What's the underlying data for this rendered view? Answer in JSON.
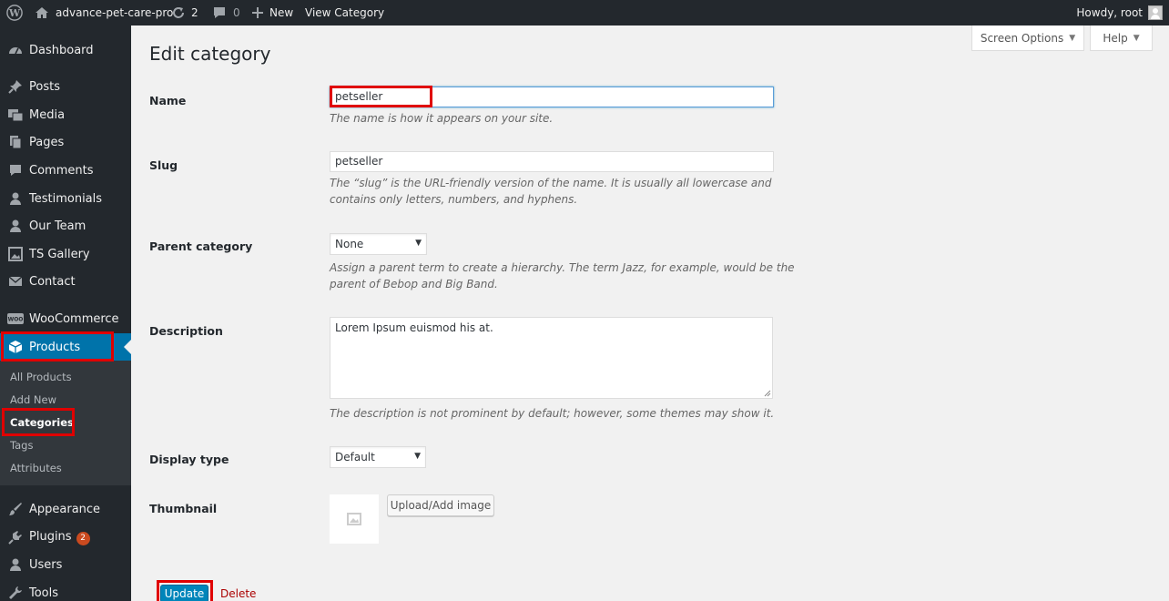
{
  "adminbar": {
    "site_name": "advance-pet-care-pro",
    "updates_count": "2",
    "comments_count": "0",
    "new_label": "New",
    "view_label": "View Category",
    "howdy": "Howdy, root"
  },
  "sidebar": {
    "items": [
      {
        "label": "Dashboard",
        "icon": "dashboard-icon"
      },
      {
        "label": "Posts",
        "icon": "pin-icon"
      },
      {
        "label": "Media",
        "icon": "media-icon"
      },
      {
        "label": "Pages",
        "icon": "pages-icon"
      },
      {
        "label": "Comments",
        "icon": "comment-icon"
      },
      {
        "label": "Testimonials",
        "icon": "person-icon"
      },
      {
        "label": "Our Team",
        "icon": "person-icon"
      },
      {
        "label": "TS Gallery",
        "icon": "gallery-icon"
      },
      {
        "label": "Contact",
        "icon": "mail-icon"
      },
      {
        "label": "WooCommerce",
        "icon": "woo-icon"
      },
      {
        "label": "Products",
        "icon": "box-icon"
      },
      {
        "label": "Appearance",
        "icon": "brush-icon"
      },
      {
        "label": "Plugins",
        "icon": "plugin-icon",
        "badge": "2"
      },
      {
        "label": "Users",
        "icon": "user-icon"
      },
      {
        "label": "Tools",
        "icon": "wrench-icon"
      }
    ],
    "submenu": [
      "All Products",
      "Add New",
      "Categories",
      "Tags",
      "Attributes"
    ]
  },
  "screen_options": "Screen Options",
  "help": "Help",
  "page_title": "Edit category",
  "form": {
    "name_label": "Name",
    "name_value": "petseller",
    "name_desc": "The name is how it appears on your site.",
    "slug_label": "Slug",
    "slug_value": "petseller",
    "slug_desc": "The “slug” is the URL-friendly version of the name. It is usually all lowercase and contains only letters, numbers, and hyphens.",
    "parent_label": "Parent category",
    "parent_value": "None",
    "parent_desc": "Assign a parent term to create a hierarchy. The term Jazz, for example, would be the parent of Bebop and Big Band.",
    "description_label": "Description",
    "description_value": "Lorem Ipsum euismod his at.",
    "description_desc": "The description is not prominent by default; however, some themes may show it.",
    "display_label": "Display type",
    "display_value": "Default",
    "thumbnail_label": "Thumbnail",
    "upload_label": "Upload/Add image"
  },
  "actions": {
    "update": "Update",
    "delete": "Delete"
  },
  "colors": {
    "adminbar_bg": "#23282d",
    "accent": "#0073aa",
    "highlight_border": "#e00000",
    "delete": "#aa0000"
  }
}
